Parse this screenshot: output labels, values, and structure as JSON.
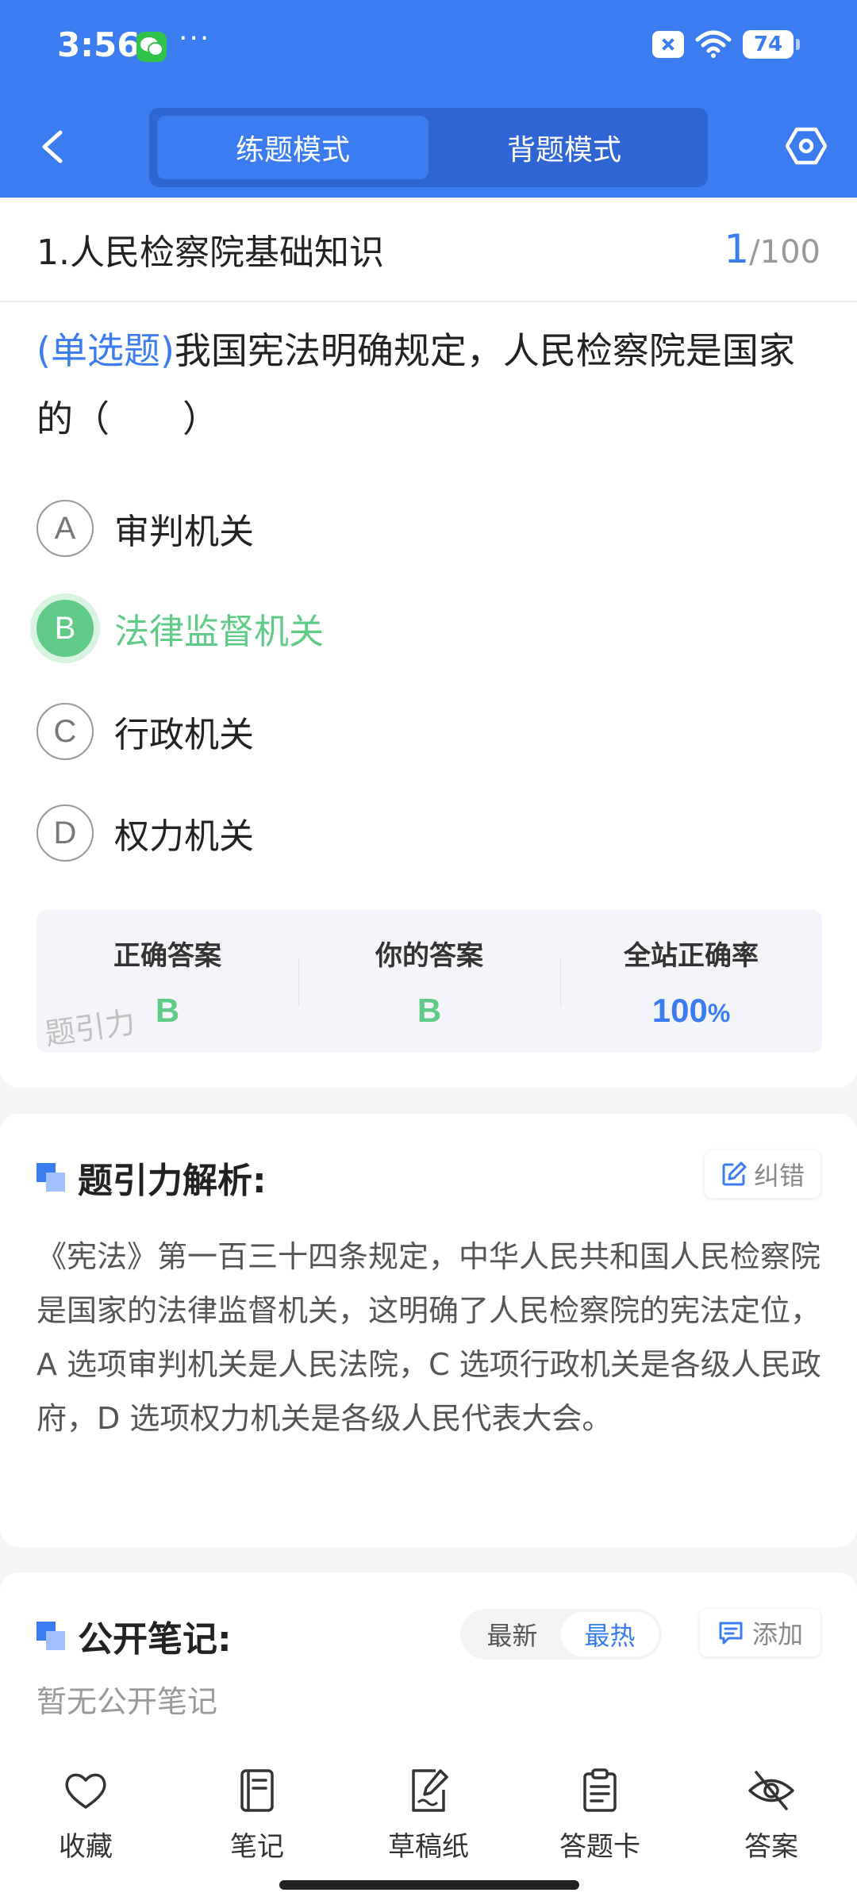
{
  "status_bar": {
    "time": "3:56",
    "dots": "···",
    "battery": "74"
  },
  "header": {
    "modes": [
      {
        "label": "练题模式",
        "active": true
      },
      {
        "label": "背题模式",
        "active": false
      }
    ]
  },
  "question": {
    "chapter": "1.人民检察院基础知识",
    "progress_current": "1",
    "progress_total": "/100",
    "type": "(单选题)",
    "text": "我国宪法明确规定，人民检察院是国家的（　　）",
    "options": [
      {
        "letter": "A",
        "text": "审判机关"
      },
      {
        "letter": "B",
        "text": "法律监督机关",
        "correct": true
      },
      {
        "letter": "C",
        "text": "行政机关"
      },
      {
        "letter": "D",
        "text": "权力机关"
      }
    ]
  },
  "answers": {
    "correct_label": "正确答案",
    "correct_value": "B",
    "yours_label": "你的答案",
    "yours_value": "B",
    "rate_label": "全站正确率",
    "rate_value": "100",
    "rate_unit": "%",
    "watermark": "题引力"
  },
  "analysis": {
    "title": "题引力解析:",
    "correct_btn": "纠错",
    "text": "《宪法》第一百三十四条规定，中华人民共和国人民检察院是国家的法律监督机关，这明确了人民检察院的宪法定位，A 选项审判机关是人民法院，C 选项行政机关是各级人民政府，D 选项权力机关是各级人民代表大会。"
  },
  "notes": {
    "title": "公开笔记:",
    "sort_newest": "最新",
    "sort_hottest": "最热",
    "add_btn": "添加",
    "empty_text": "暂无公开笔记"
  },
  "bottom_bar": [
    {
      "label": "收藏",
      "icon": "heart-icon"
    },
    {
      "label": "笔记",
      "icon": "notebook-icon"
    },
    {
      "label": "草稿纸",
      "icon": "draft-paper-icon"
    },
    {
      "label": "答题卡",
      "icon": "answer-sheet-icon"
    },
    {
      "label": "答案",
      "icon": "eye-off-icon"
    }
  ],
  "colors": {
    "primary": "#3b7cf0",
    "correct": "#5fcb87"
  }
}
